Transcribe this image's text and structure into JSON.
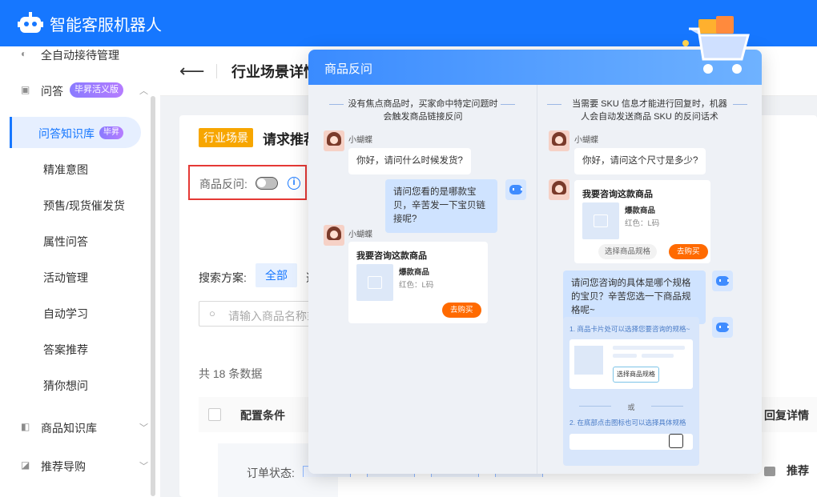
{
  "app": {
    "title": "智能客服机器人"
  },
  "sidebar": {
    "items": [
      {
        "label": "全自动接待管理"
      },
      {
        "label": "问答",
        "badge": "毕昇活义版"
      },
      {
        "label": "问答知识库",
        "badge": "毕昇"
      },
      {
        "label": "精准意图"
      },
      {
        "label": "预售/现货催发货"
      },
      {
        "label": "属性问答"
      },
      {
        "label": "活动管理"
      },
      {
        "label": "自动学习"
      },
      {
        "label": "答案推荐"
      },
      {
        "label": "猜你想问"
      },
      {
        "label": "商品知识库"
      },
      {
        "label": "推荐导购"
      }
    ]
  },
  "header": {
    "title": "行业场景详情"
  },
  "card1": {
    "tag": "行业场景",
    "title": "请求推荐",
    "toggle_label": "商品反问:",
    "toggle_on": false
  },
  "filters": {
    "scheme_label": "搜索方案:",
    "all_chip": "全部",
    "more_chip": "选",
    "search_placeholder": "请输入商品名称或"
  },
  "table": {
    "count_text": "共 18 条数据",
    "col_condition": "配置条件",
    "col_reply": "回复详情",
    "order_status_label": "订单状态:",
    "reply_text": "推荐"
  },
  "modal": {
    "title": "商品反问",
    "left": {
      "heading": "没有焦点商品时，买家命中特定问题时会触发商品链接反问",
      "user_name_1": "小蝴蝶",
      "user_msg_1": "你好，请问什么时候发货?",
      "bot_msg_1": "请问您看的是哪款宝贝，辛苦发一下宝贝链接呢?",
      "user_name_2": "小蝴蝶",
      "card_title": "我要咨询这款商品",
      "card_product": "爆款商品",
      "card_spec": "红色：L码",
      "card_buy": "去购买"
    },
    "right": {
      "heading": "当需要 SKU 信息才能进行回复时，机器人会自动发送商品 SKU 的反问话术",
      "user_name_1": "小蝴蝶",
      "user_msg_1": "你好，请问这个尺寸是多少?",
      "card_title": "我要咨询这款商品",
      "card_product": "爆款商品",
      "card_spec": "红色：L码",
      "card_select": "选择商品规格",
      "card_buy": "去购买",
      "bot_msg_1": "请问您咨询的具体是哪个规格的宝贝？辛苦您选一下商品规格呢~",
      "guide_1": "1. 商品卡片处可以选择您要咨询的规格~",
      "guide_btn": "选择商品规格",
      "guide_or": "或",
      "guide_2": "2. 在底部点击图标也可以选择具体规格"
    }
  },
  "colors": {
    "primary": "#1677ff",
    "orange": "#f7a600",
    "buy": "#ff6a00"
  }
}
